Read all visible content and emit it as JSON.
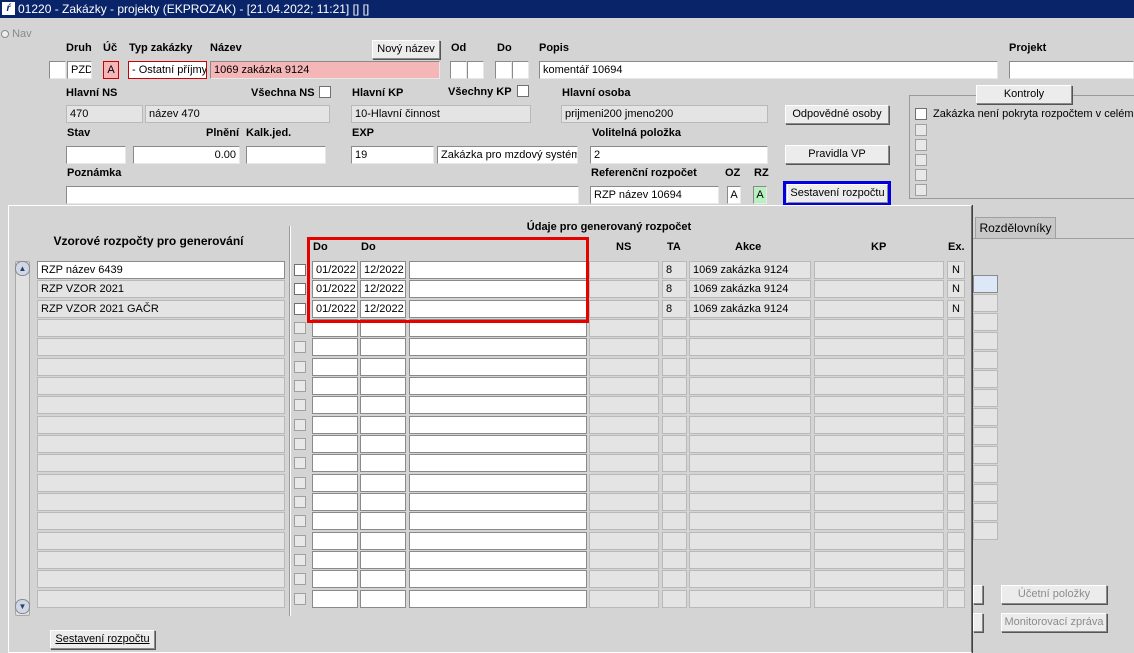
{
  "window_title": "01220 - Zakázky - projekty (EKPROZAK) - [21.04.2022; 11:21] [] []",
  "nav_label": "Nav",
  "header": {
    "labels": {
      "druh": "Druh",
      "uc": "Úč",
      "typ": "Typ zakázky",
      "nazev": "Název",
      "od": "Od",
      "do": "Do",
      "popis": "Popis",
      "projekt": "Projekt",
      "hlavni_ns": "Hlavní NS",
      "vsechna_ns": "Všechna NS",
      "hlavni_kp": "Hlavní KP",
      "vsechny_kp": "Všechny KP",
      "hlavni_osoba": "Hlavní osoba",
      "stav": "Stav",
      "plneni": "Plnění",
      "kalk_jed": "Kalk.jed.",
      "exp": "EXP",
      "volitelna": "Volitelná položka",
      "poznamka": "Poznámka",
      "ref_rozpocet": "Referenční rozpočet",
      "oz": "OZ",
      "rz": "RZ"
    },
    "values": {
      "druh": "PZD",
      "uc": "A",
      "typ": "- Ostatní příjmy",
      "nazev": "1069 zakázka 9124",
      "popis": "komentář 10694",
      "projekt": "",
      "ns_code": "470",
      "ns_name": "název 470",
      "kp": "10-Hlavní činnost",
      "osoba": "prijmeni200 jmeno200",
      "stav": "",
      "plneni": "0.00",
      "kalk_jed": "",
      "exp_code": "19",
      "exp_name": "Zakázka pro mzdový systém",
      "volitelna": "2",
      "poznamka": "",
      "ref_rozpocet": "RZP název 10694",
      "oz": "A",
      "rz": "A"
    },
    "buttons": {
      "novy_nazev": "Nový název",
      "odpovedne": "Odpovědné osoby",
      "pravidla": "Pravidla VP",
      "sestaveni": "Sestavení rozpočtu"
    }
  },
  "right_panel": {
    "kontroly": "Kontroly",
    "check_first": "Zakázka není pokryta rozpočtem v celém",
    "tab": "Rozdělovníky",
    "ucetni": "Účetní položky",
    "monitor": "Monitorovací zpráva"
  },
  "dialog": {
    "left_header": "Vzorové rozpočty pro generování",
    "right_title": "Údaje pro generovaný rozpočet",
    "columns": {
      "do1": "Do",
      "do2": "Do",
      "ns": "NS",
      "ta": "TA",
      "akce": "Akce",
      "kp": "KP",
      "ex": "Ex."
    },
    "templates": [
      "RZP název 6439",
      "RZP VZOR 2021",
      "RZP VZOR 2021 GAČR"
    ],
    "rows": [
      {
        "od": "01/2022",
        "do": "12/2022",
        "ta": "8",
        "akce": "1069 zakázka 9124",
        "ex": "N"
      },
      {
        "od": "01/2022",
        "do": "12/2022",
        "ta": "8",
        "akce": "1069 zakázka 9124",
        "ex": "N"
      },
      {
        "od": "01/2022",
        "do": "12/2022",
        "ta": "8",
        "akce": "1069 zakázka 9124",
        "ex": "N"
      }
    ],
    "footer_button": "Sestavení rozpočtu"
  },
  "colors": {
    "highlight_red": "#e60000",
    "highlight_blue": "#0000e0",
    "title_bg": "#0a246a"
  }
}
